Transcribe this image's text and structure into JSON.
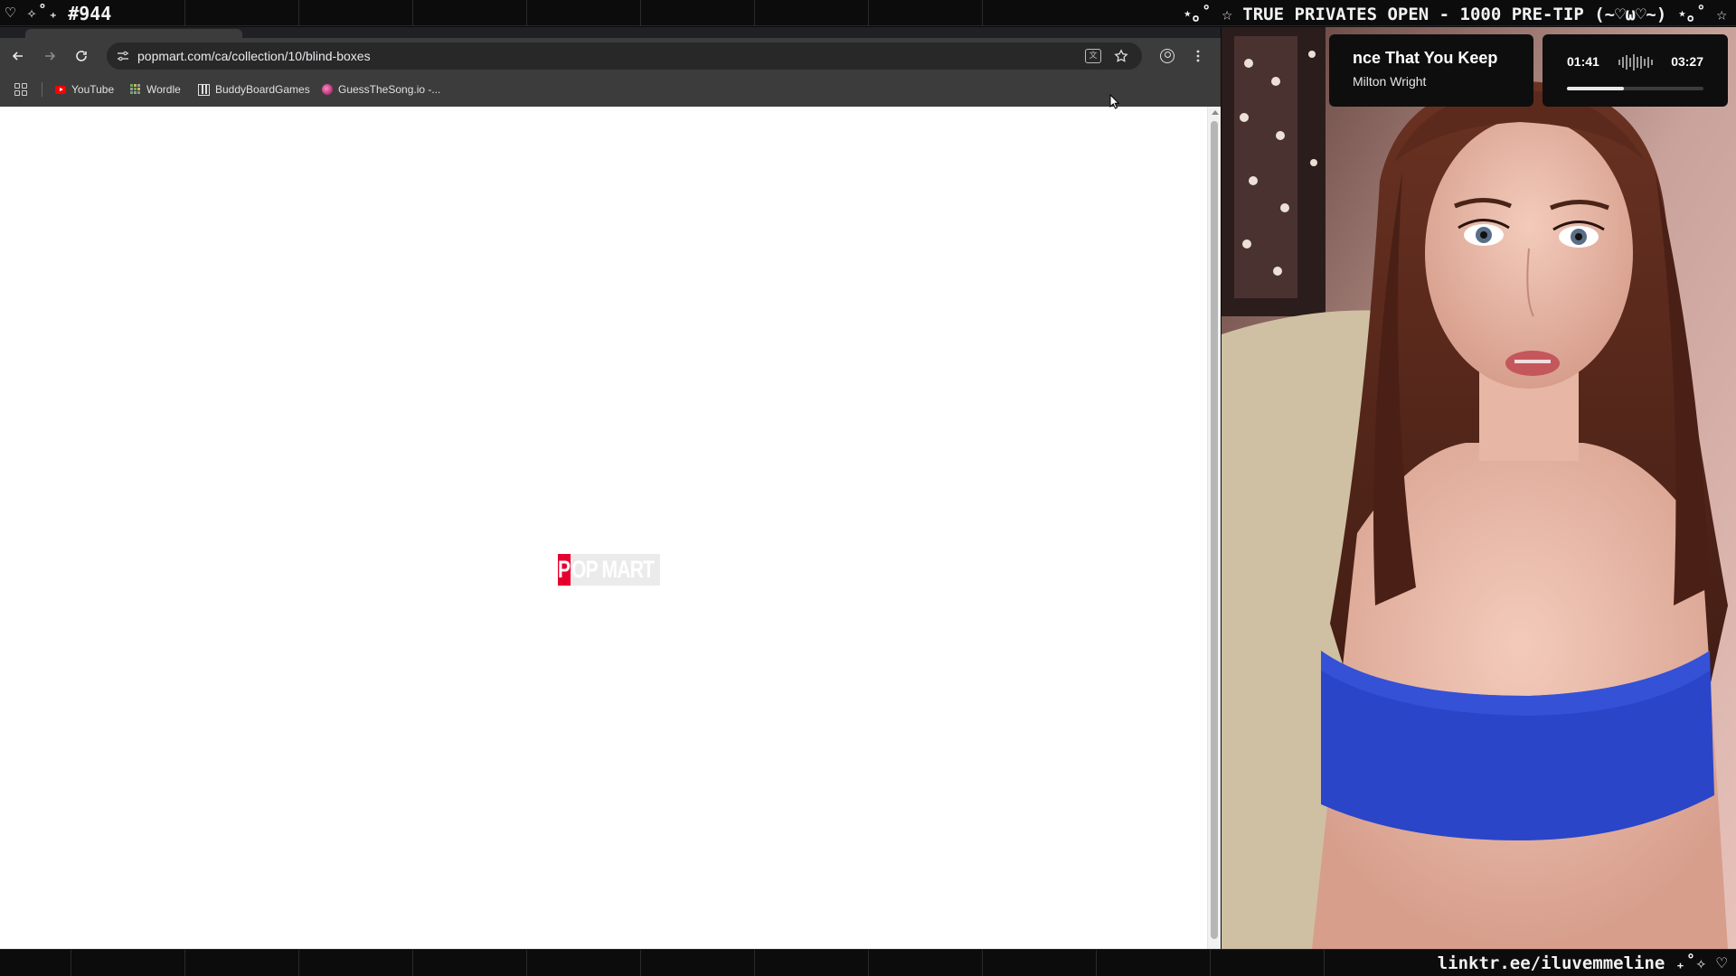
{
  "overlay": {
    "top_left_deco": "♡ ✧˚₊",
    "stream_number": "#944",
    "top_right_text": "⋆｡˚ ☆ TRUE PRIVATES OPEN - 1000 PRE-TIP (~♡ω♡~) ⋆｡˚ ☆",
    "bottom_right_text": "linktr.ee/iluvemmeline ₊˚✧ ♡"
  },
  "browser": {
    "url": "popmart.com/ca/collection/10/blind-boxes",
    "bookmarks": [
      {
        "label": "YouTube",
        "icon": "youtube-icon"
      },
      {
        "label": "Wordle",
        "icon": "wordle-icon"
      },
      {
        "label": "BuddyBoardGames",
        "icon": "buddyboardgames-icon"
      },
      {
        "label": "GuessTheSong.io -...",
        "icon": "guessthesong-icon"
      }
    ],
    "page": {
      "logo_first_letter": "P",
      "logo_rest": "OP MART",
      "logo_color": "#e6002d"
    },
    "page_scroll_fraction": 0.0
  },
  "music": {
    "song": "nce That You Keep",
    "artist": "Milton Wright",
    "elapsed": "01:41",
    "total": "03:27",
    "progress": 0.42
  }
}
